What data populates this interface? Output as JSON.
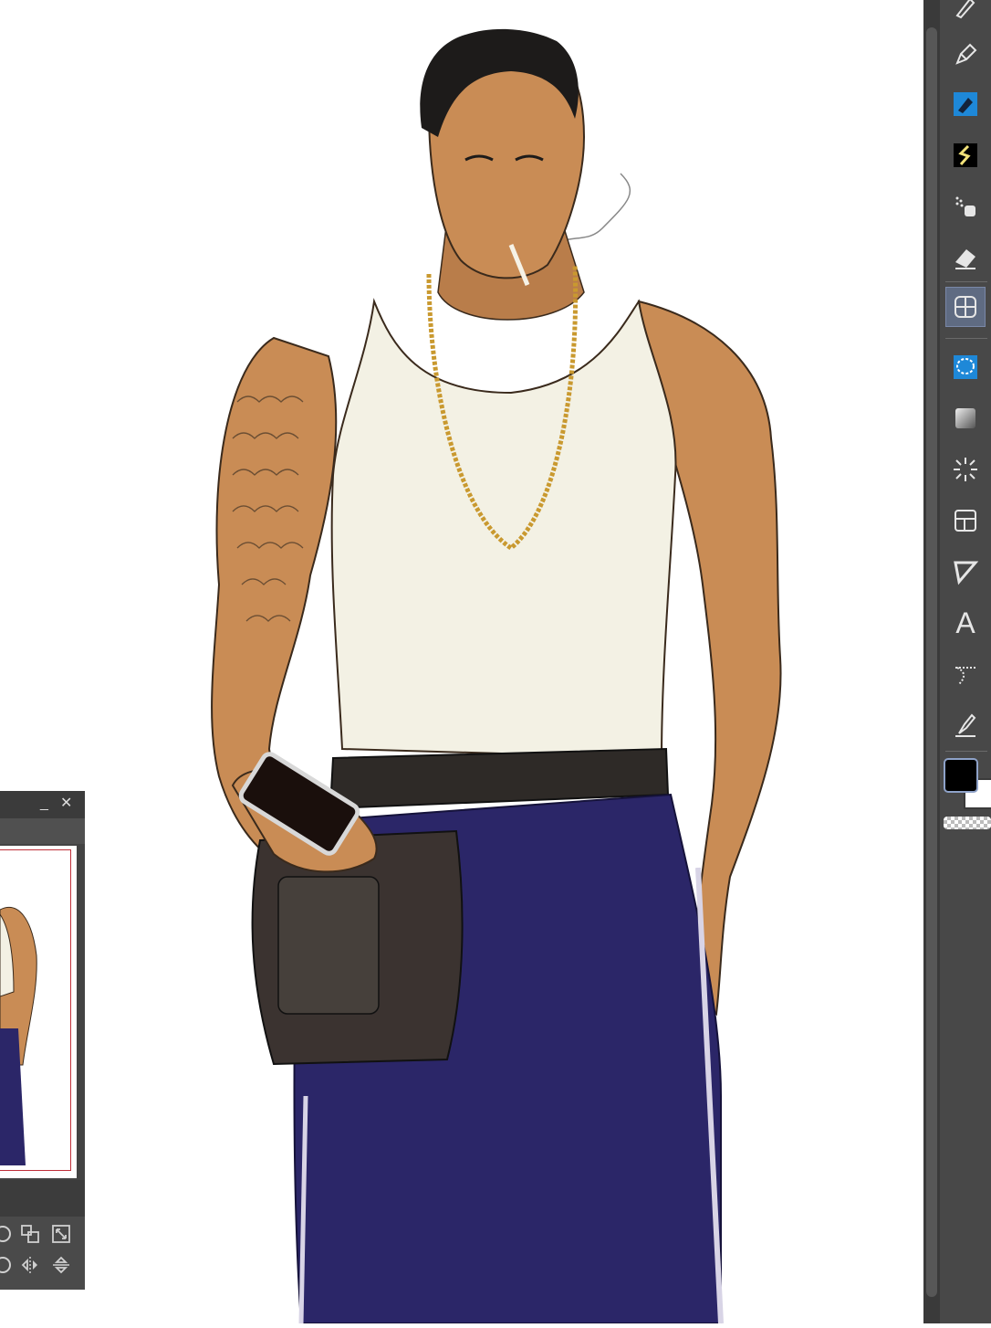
{
  "app": {
    "accent_color": "#1e88d8",
    "active_tool_bg": "#5f6b82"
  },
  "canvas": {
    "subject": "illustration-character",
    "colors": {
      "skin": "#c98c55",
      "tank_top": "#f3f1e4",
      "pants": "#2b2668",
      "belt": "#2e2a27",
      "chain": "#c9992f",
      "hair": "#1d1b1a"
    }
  },
  "toolbar": {
    "tools": [
      {
        "name": "pen-icon"
      },
      {
        "name": "pencil-icon"
      },
      {
        "name": "marker-icon",
        "selected_color": "#1e88d8"
      },
      {
        "name": "decoration-icon"
      },
      {
        "name": "airbrush-icon"
      },
      {
        "name": "eraser-icon"
      },
      {
        "name": "transform-mesh-icon",
        "active": true
      },
      {
        "name": "lasso-select-icon",
        "selected_color": "#1e88d8"
      },
      {
        "name": "gradient-icon"
      },
      {
        "name": "effect-lines-icon"
      },
      {
        "name": "frame-border-icon"
      },
      {
        "name": "ruler-icon"
      },
      {
        "name": "text-icon",
        "label": "A"
      },
      {
        "name": "balloon-icon"
      },
      {
        "name": "correct-line-icon"
      }
    ],
    "colors": {
      "main": "#000000",
      "sub": "#ffffff"
    }
  },
  "navigator": {
    "minimize_label": "_",
    "close_label": "✕",
    "frame_color": "#c0303a",
    "buttons": [
      {
        "name": "rotate-left-icon"
      },
      {
        "name": "zoom-fit-icon"
      },
      {
        "name": "fit-window-icon"
      },
      {
        "name": "rotate-reset-icon"
      },
      {
        "name": "flip-horizontal-icon"
      },
      {
        "name": "flip-vertical-icon"
      }
    ]
  }
}
